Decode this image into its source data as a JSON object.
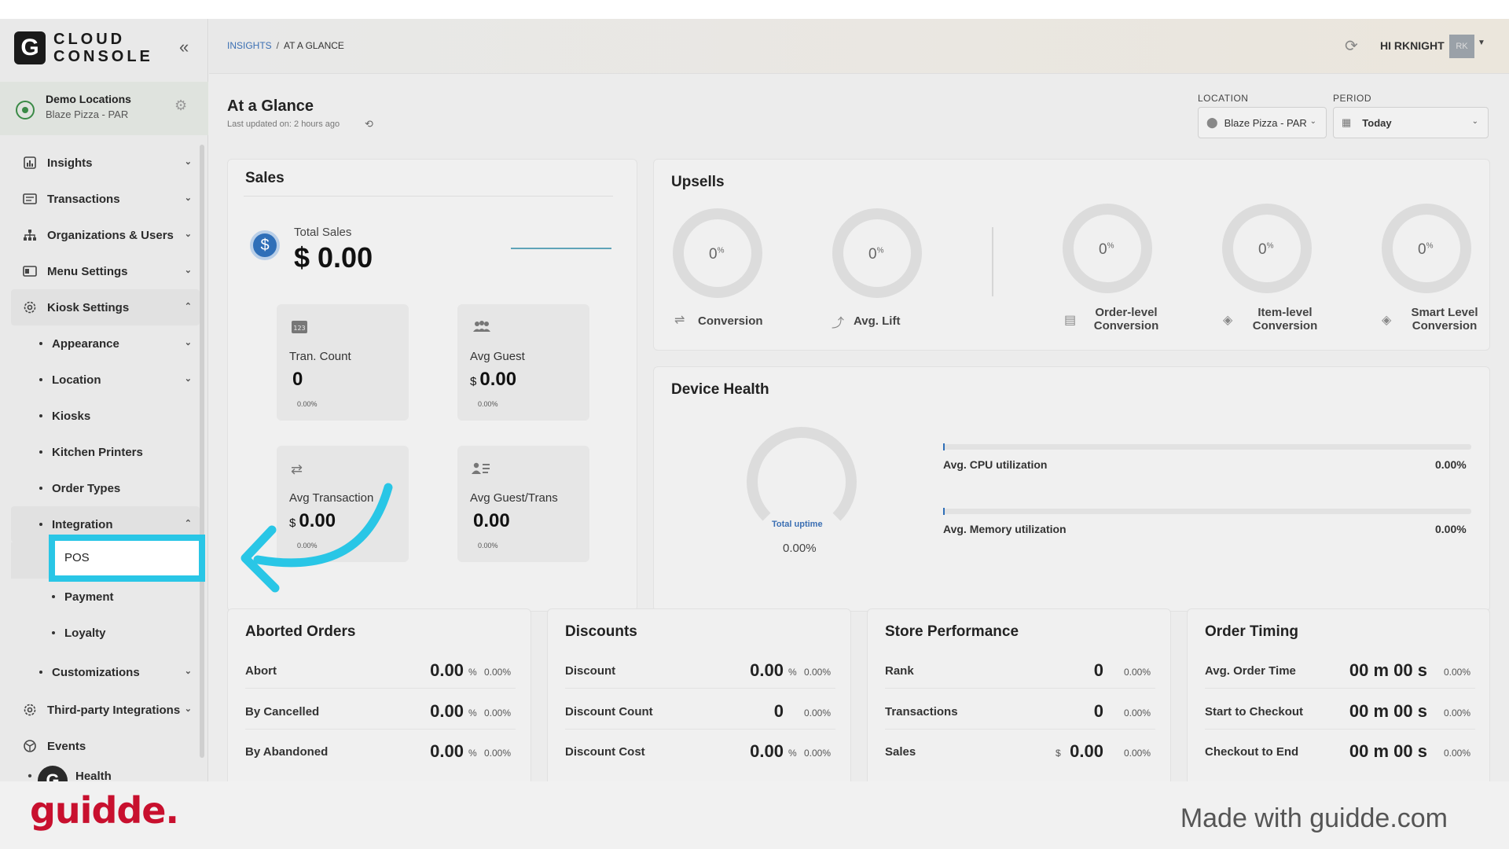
{
  "app": {
    "logo_letter": "G",
    "logo_line1": "CLOUD",
    "logo_line2": "CONSOLE",
    "location_title": "Demo Locations",
    "location_sub": "Blaze Pizza - PAR"
  },
  "sidebar": {
    "items": [
      {
        "label": "Insights"
      },
      {
        "label": "Transactions"
      },
      {
        "label": "Organizations & Users"
      },
      {
        "label": "Menu Settings"
      },
      {
        "label": "Kiosk Settings"
      },
      {
        "label": "Appearance"
      },
      {
        "label": "Location"
      },
      {
        "label": "Kiosks"
      },
      {
        "label": "Kitchen Printers"
      },
      {
        "label": "Order Types"
      },
      {
        "label": "Integration"
      },
      {
        "label": "POS"
      },
      {
        "label": "Payment"
      },
      {
        "label": "Loyalty"
      },
      {
        "label": "Customizations"
      },
      {
        "label": "Third-party Integrations"
      },
      {
        "label": "Events"
      },
      {
        "label": "Health"
      }
    ]
  },
  "header": {
    "breadcrumb_link": "INSIGHTS",
    "breadcrumb_sep": "/",
    "breadcrumb_current": "AT A GLANCE",
    "user": "HI RKNIGHT",
    "avatar_initials": "RK"
  },
  "page": {
    "title": "At a Glance",
    "subtitle": "Last updated on: 2 hours ago",
    "location_label": "LOCATION",
    "location_value": "Blaze Pizza - PAR",
    "period_label": "PERIOD",
    "period_value": "Today"
  },
  "sales": {
    "title": "Sales",
    "total_label": "Total Sales",
    "total_value": "$ 0.00",
    "tiles": [
      {
        "label": "Tran. Count",
        "currency": "",
        "value": "0",
        "pct": "0.00%"
      },
      {
        "label": "Avg Guest",
        "currency": "$",
        "value": "0.00",
        "pct": "0.00%"
      },
      {
        "label": "Avg Transaction",
        "currency": "$",
        "value": "0.00",
        "pct": "0.00%"
      },
      {
        "label": "Avg Guest/Trans",
        "currency": "",
        "value": "0.00",
        "pct": "0.00%"
      }
    ]
  },
  "upsells": {
    "title": "Upsells",
    "items": [
      {
        "value": "0",
        "unit": "%",
        "label1": "Conversion",
        "label2": ""
      },
      {
        "value": "0",
        "unit": "%",
        "label1": "Avg. Lift",
        "label2": ""
      },
      {
        "value": "0",
        "unit": "%",
        "label1": "Order-level",
        "label2": "Conversion"
      },
      {
        "value": "0",
        "unit": "%",
        "label1": "Item-level",
        "label2": "Conversion"
      },
      {
        "value": "0",
        "unit": "%",
        "label1": "Smart Level",
        "label2": "Conversion"
      }
    ]
  },
  "device_health": {
    "title": "Device Health",
    "uptime_label": "Total uptime",
    "uptime_value": "0.00%",
    "cpu_label": "Avg. CPU utilization",
    "cpu_value": "0.00%",
    "mem_label": "Avg. Memory utilization",
    "mem_value": "0.00%"
  },
  "aborted": {
    "title": "Aborted Orders",
    "rows": [
      {
        "label": "Abort",
        "value": "0.00",
        "unit": "%",
        "pct": "0.00%"
      },
      {
        "label": "By Cancelled",
        "value": "0.00",
        "unit": "%",
        "pct": "0.00%"
      },
      {
        "label": "By Abandoned",
        "value": "0.00",
        "unit": "%",
        "pct": "0.00%"
      }
    ]
  },
  "discounts": {
    "title": "Discounts",
    "rows": [
      {
        "label": "Discount",
        "value": "0.00",
        "unit": "%",
        "pct": "0.00%"
      },
      {
        "label": "Discount Count",
        "value": "0",
        "unit": "",
        "pct": "0.00%"
      },
      {
        "label": "Discount Cost",
        "value": "0.00",
        "unit": "%",
        "pct": "0.00%"
      }
    ]
  },
  "store": {
    "title": "Store Performance",
    "rows": [
      {
        "label": "Rank",
        "prefix": "",
        "value": "0",
        "pct": "0.00%"
      },
      {
        "label": "Transactions",
        "prefix": "",
        "value": "0",
        "pct": "0.00%"
      },
      {
        "label": "Sales",
        "prefix": "$",
        "value": "0.00",
        "pct": "0.00%"
      }
    ]
  },
  "timing": {
    "title": "Order Timing",
    "rows": [
      {
        "label": "Avg. Order Time",
        "value": "00 m 00 s",
        "pct": "0.00%"
      },
      {
        "label": "Start to Checkout",
        "value": "00 m 00 s",
        "pct": "0.00%"
      },
      {
        "label": "Checkout to End",
        "value": "00 m 00 s",
        "pct": "0.00%"
      }
    ]
  },
  "footer": {
    "brand": "guidde.",
    "made_with": "Made with guidde.com"
  },
  "colors": {
    "highlight": "#29c6e6",
    "brand_red": "#c8102e",
    "link_blue": "#3b6fb3"
  }
}
